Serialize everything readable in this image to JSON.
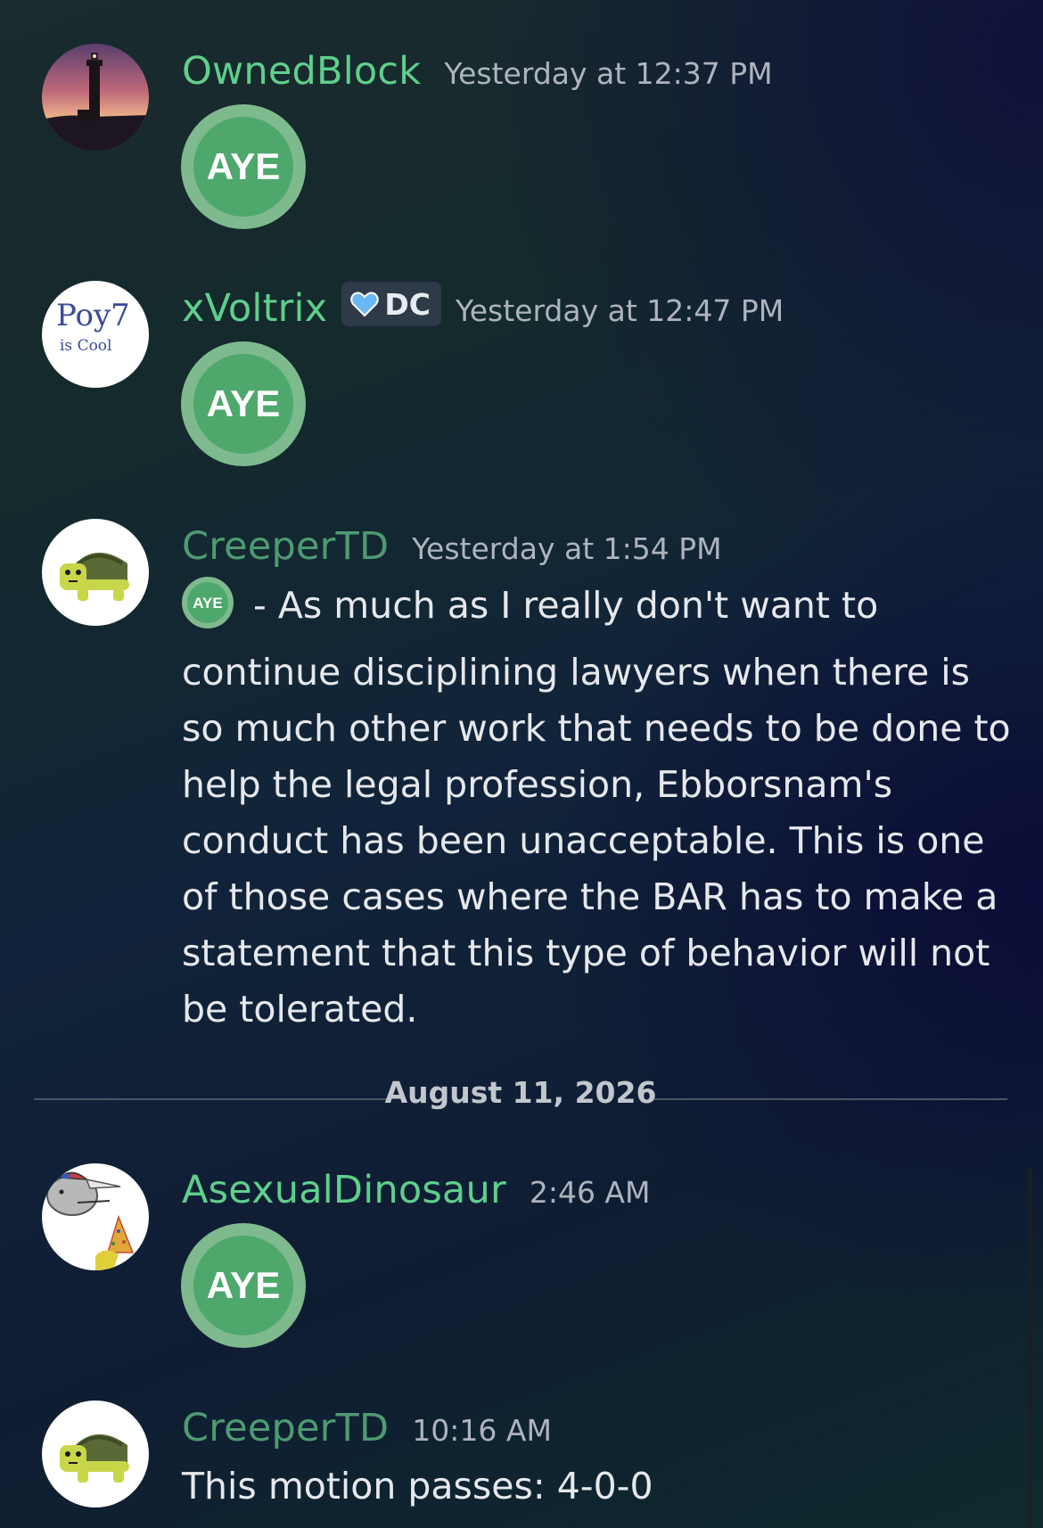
{
  "colors": {
    "name_green": "#5fcf8b",
    "name_dim_green": "#4e9a72",
    "aye_outer": "#7fb98e",
    "aye_inner": "#4ea86c"
  },
  "messages": [
    {
      "username": "OwnedBlock",
      "timestamp": "Yesterday at 12:37 PM",
      "emoji": "AYE"
    },
    {
      "username": "xVoltrix",
      "tag": "DC",
      "timestamp": "Yesterday at 12:47 PM",
      "emoji": "AYE"
    },
    {
      "username": "CreeperTD",
      "timestamp": "Yesterday at 1:54 PM",
      "inline_emoji": "AYE",
      "text": "- As much as I really don't want to continue disciplining lawyers when there is so much other work that needs to be done to help the legal profession, Ebborsnam's conduct has been unacceptable. This is one of those cases where the BAR has to make a statement that this type of behavior will not be tolerated."
    },
    {
      "username": "AsexualDinosaur",
      "timestamp": "2:46 AM",
      "emoji": "AYE"
    },
    {
      "username": "CreeperTD",
      "timestamp": "10:16 AM",
      "text": "This motion passes: 4-0-0"
    }
  ],
  "divider": {
    "date": "August 11, 2026"
  },
  "avatar_lettering": {
    "xvoltrix_line1": "Poy7",
    "xvoltrix_line2": "is Cool"
  }
}
